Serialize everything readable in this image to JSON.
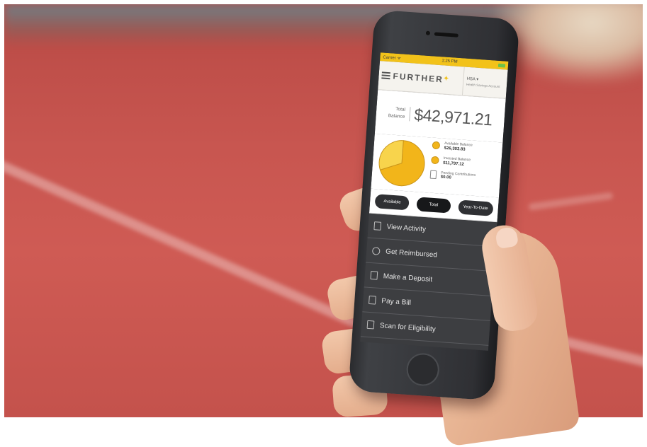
{
  "status_bar": {
    "carrier": "Carrier ᯤ",
    "time": "1:25 PM"
  },
  "header": {
    "brand": "FURTHER",
    "account_name": "HSA ▾",
    "account_sub": "Health Savings Account"
  },
  "balance": {
    "label_line1": "Total",
    "label_line2": "Balance",
    "amount": "$42,971.21"
  },
  "legend": [
    {
      "label": "Available Balance",
      "amount": "$26,303.83"
    },
    {
      "label": "Invested Balance",
      "amount": "$11,797.12"
    },
    {
      "label": "Pending Contributions",
      "amount": "$0.00"
    }
  ],
  "chart_data": {
    "type": "pie",
    "slices": [
      {
        "label": "Available Balance",
        "value": 26303.83,
        "color": "#f2b51a"
      },
      {
        "label": "Invested Balance",
        "value": 11797.12,
        "color": "#f8d44c"
      }
    ]
  },
  "tabs": [
    "Available",
    "Total",
    "Year-To-Date"
  ],
  "active_tab": "Total",
  "menu": [
    {
      "label": "View Activity",
      "icon": "document-icon"
    },
    {
      "label": "Get Reimbursed",
      "icon": "reimburse-icon"
    },
    {
      "label": "Make a Deposit",
      "icon": "deposit-icon"
    },
    {
      "label": "Pay a Bill",
      "icon": "bill-icon"
    },
    {
      "label": "Scan for Eligibility",
      "icon": "scan-icon"
    }
  ],
  "colors": {
    "accent": "#f2c21a",
    "track": "#c85650",
    "menu_bg": "#3d3e41"
  }
}
